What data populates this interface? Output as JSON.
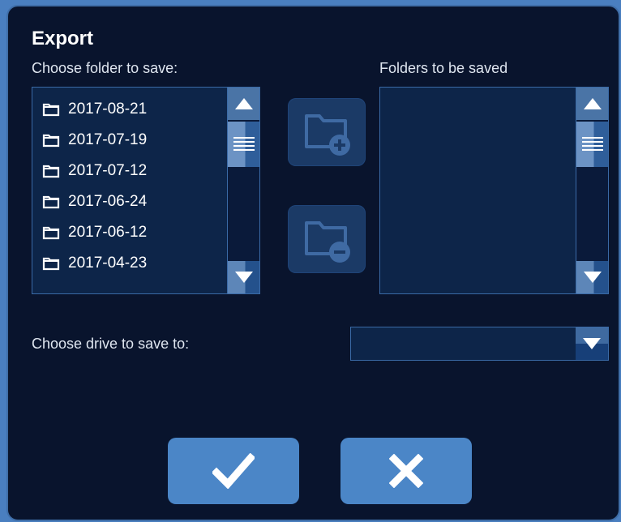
{
  "dialog": {
    "title": "Export",
    "source_label": "Choose folder to save:",
    "target_label": "Folders to be saved",
    "drive_label": "Choose drive to save to:",
    "drive_value": ""
  },
  "source_folders": [
    "2017-08-21",
    "2017-07-19",
    "2017-07-12",
    "2017-06-24",
    "2017-06-12",
    "2017-04-23"
  ],
  "target_folders": [],
  "icons": {
    "add": "folder-add-icon",
    "remove": "folder-remove-icon",
    "confirm": "checkmark-icon",
    "cancel": "close-icon",
    "scroll_up": "triangle-up-icon",
    "scroll_down": "triangle-down-icon",
    "dropdown": "triangle-down-icon"
  },
  "colors": {
    "background": "#09142d",
    "panel": "#0d2549",
    "accent": "#4b86c7"
  }
}
